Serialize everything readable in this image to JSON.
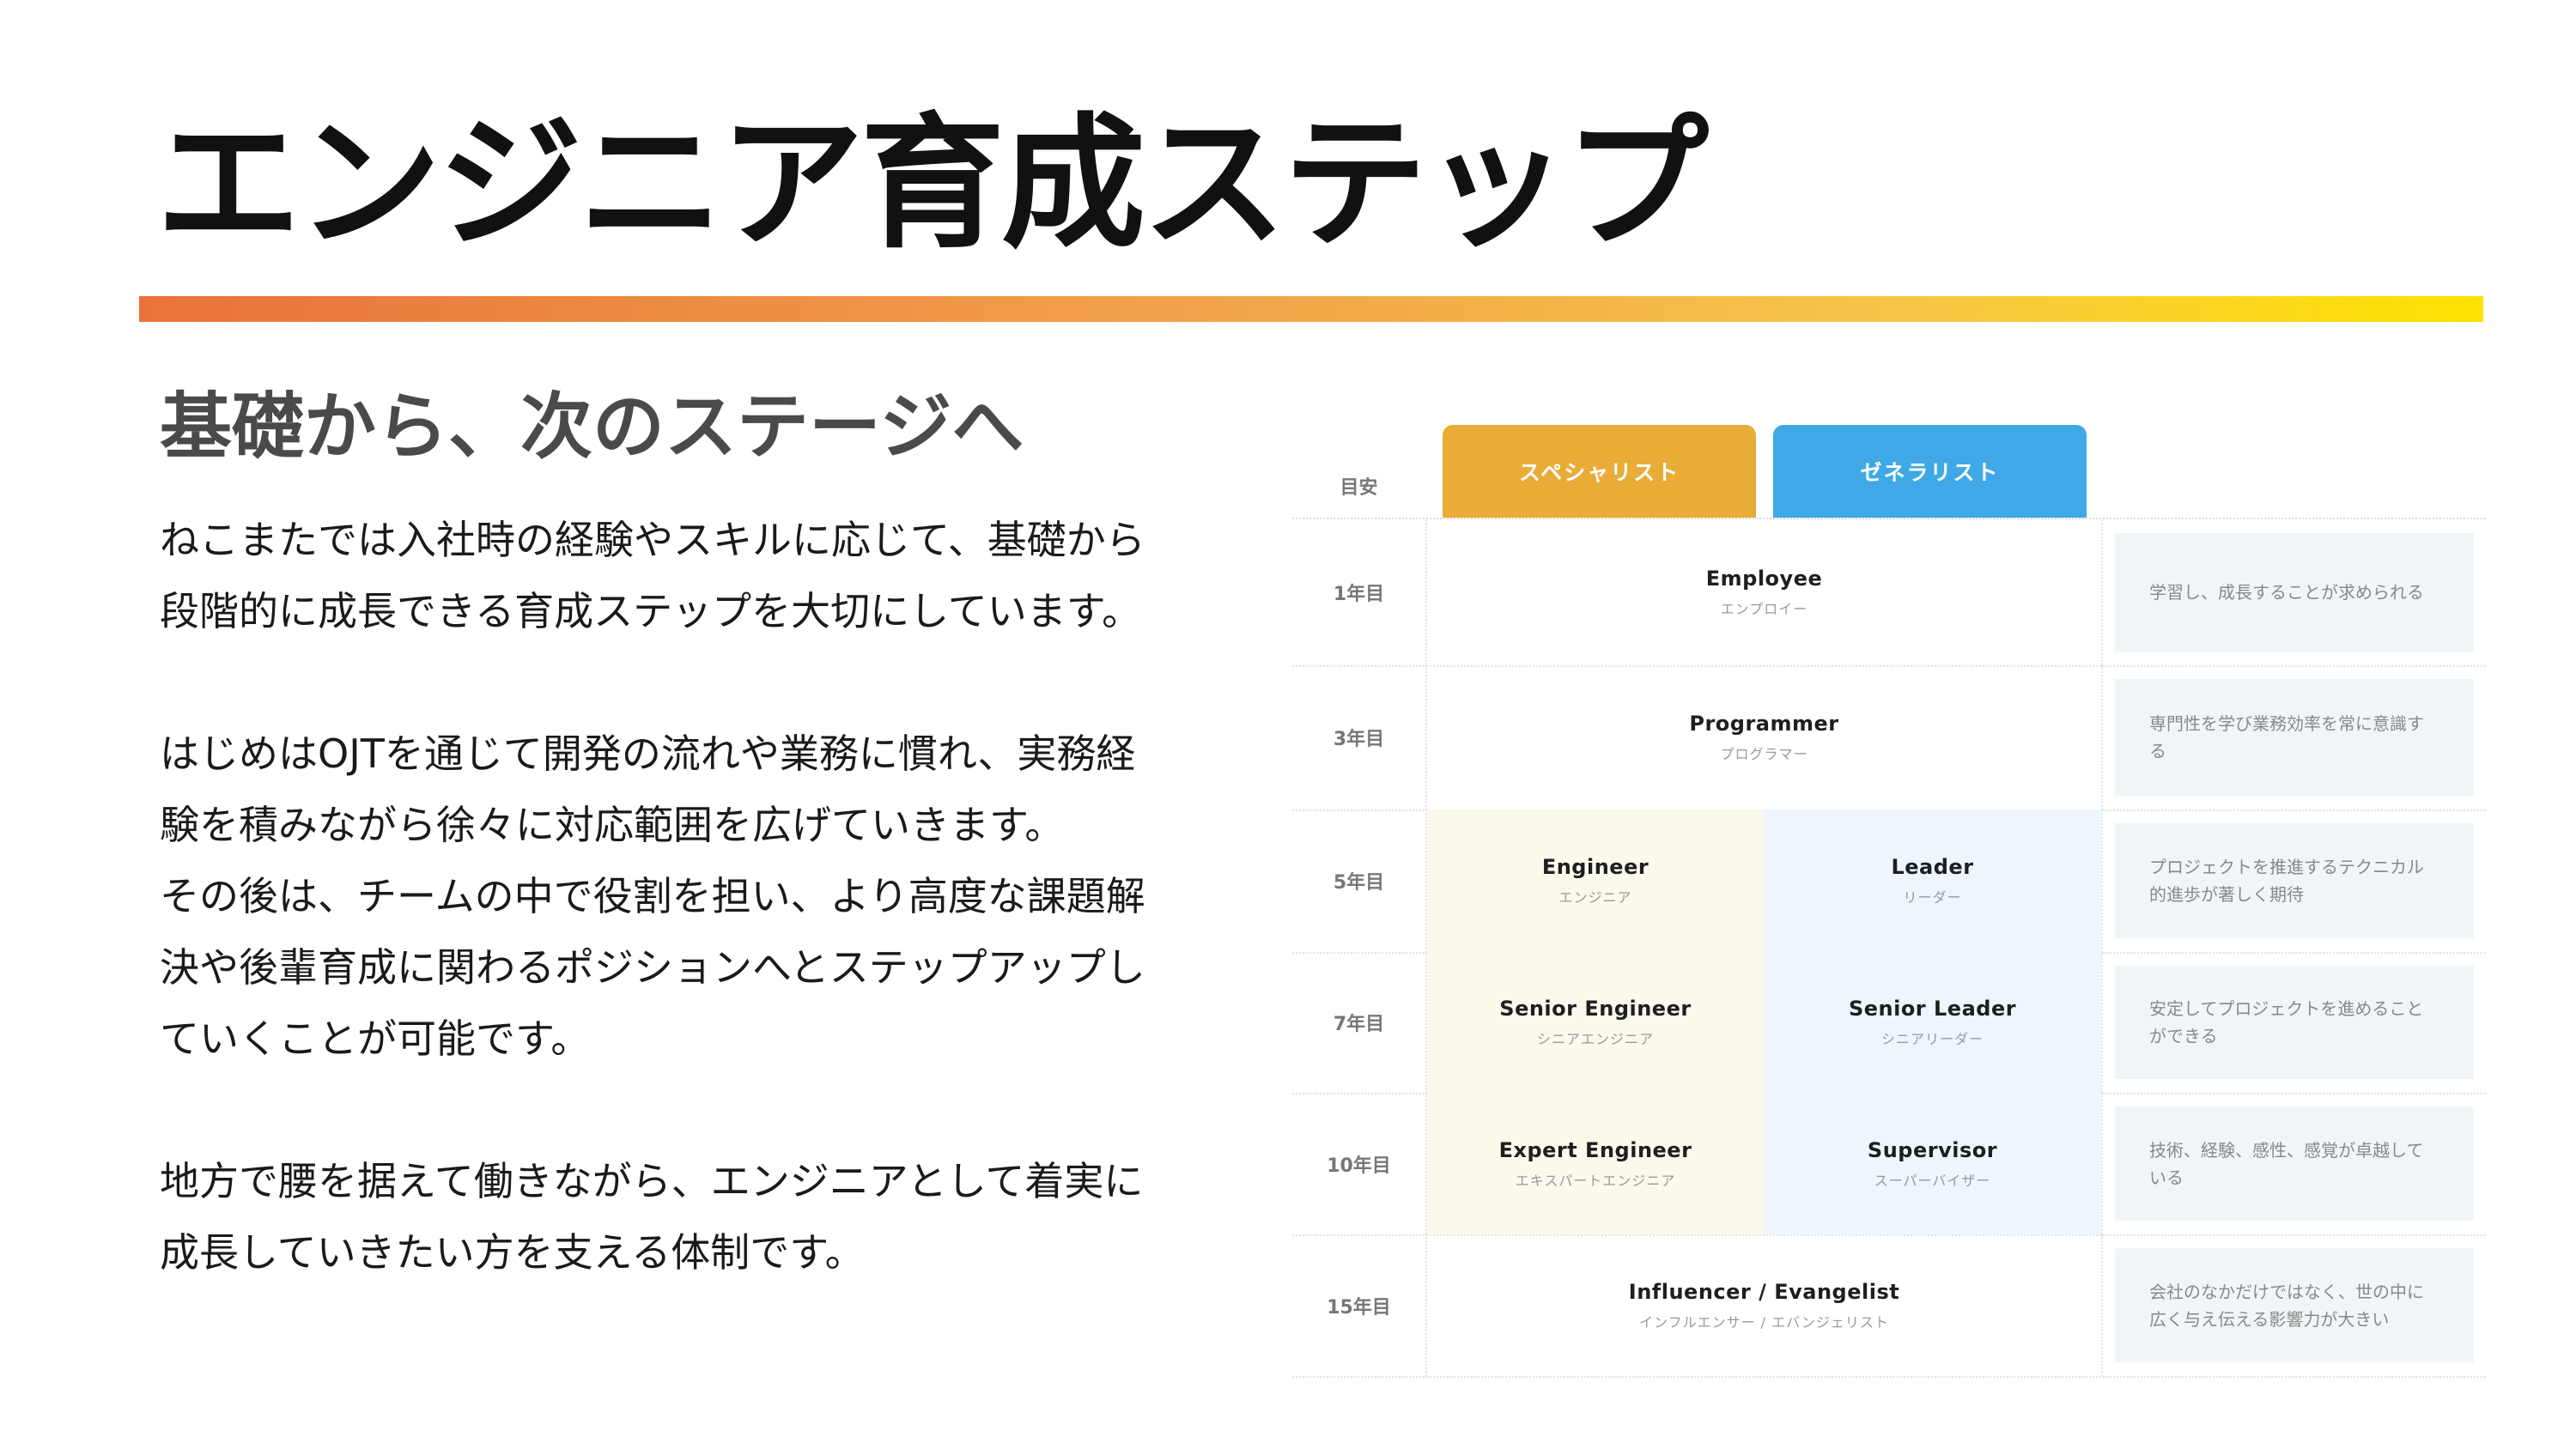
{
  "title": "エンジニア育成ステップ",
  "subtitle": "基礎から、次のステージへ",
  "paragraphs": [
    [
      "ねこまたでは入社時の経験やスキルに応じて、基礎から",
      "段階的に成長できる育成ステップを大切にしています。"
    ],
    [
      "はじめはOJTを通じて開発の流れや業務に慣れ、実務経",
      "験を積みながら徐々に対応範囲を広げていきます。"
    ],
    [
      "その後は、チームの中で役割を担い、より高度な課題解",
      "決や後輩育成に関わるポジションへとステップアップし",
      "ていくことが可能です。"
    ],
    [
      "地方で腰を据えて働きながら、エンジニアとして着実に",
      "成長していきたい方を支える体制です。"
    ]
  ],
  "table": {
    "header_label": "目安",
    "tabs": [
      "スペシャリスト",
      "ゼネラリスト"
    ],
    "colors": {
      "specialist": "#e8ac37",
      "generalist": "#3ea9e6"
    },
    "rows": [
      {
        "year": "1年目",
        "full": {
          "en": "Employee",
          "ja": "エンプロイー"
        },
        "desc": "学習し、成長することが求められる"
      },
      {
        "year": "3年目",
        "full": {
          "en": "Programmer",
          "ja": "プログラマー"
        },
        "desc": "専門性を学び業務効率を常に意識する"
      },
      {
        "year": "5年目",
        "left": {
          "en": "Engineer",
          "ja": "エンジニア"
        },
        "right": {
          "en": "Leader",
          "ja": "リーダー"
        },
        "desc": "プロジェクトを推進するテクニカル的進歩が著しく期待"
      },
      {
        "year": "7年目",
        "left": {
          "en": "Senior Engineer",
          "ja": "シニアエンジニア"
        },
        "right": {
          "en": "Senior Leader",
          "ja": "シニアリーダー"
        },
        "desc": "安定してプロジェクトを進めることができる"
      },
      {
        "year": "10年目",
        "left": {
          "en": "Expert Engineer",
          "ja": "エキスパートエンジニア"
        },
        "right": {
          "en": "Supervisor",
          "ja": "スーパーバイザー"
        },
        "desc": "技術、経験、感性、感覚が卓越している"
      },
      {
        "year": "15年目",
        "full": {
          "en": "Influencer / Evangelist",
          "ja": "インフルエンサー / エバンジェリスト"
        },
        "desc": "会社のなかだけではなく、世の中に広く与え伝える影響力が大きい"
      }
    ]
  }
}
